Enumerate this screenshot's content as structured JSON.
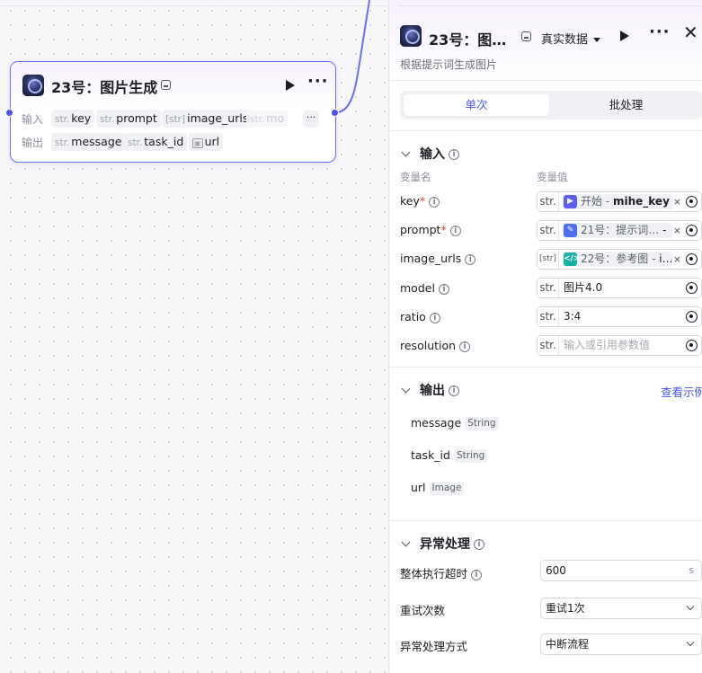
{
  "node": {
    "title": "23号：图片生成",
    "input_label": "输入",
    "output_label": "输出",
    "inputs": [
      {
        "type": "str.",
        "name": "key"
      },
      {
        "type": "str.",
        "name": "prompt"
      },
      {
        "type": "[str]",
        "name": "image_urls"
      },
      {
        "type": "str.",
        "name": "mo"
      }
    ],
    "outputs": [
      {
        "type": "str.",
        "name": "message"
      },
      {
        "type": "str.",
        "name": "task_id"
      },
      {
        "type": "img",
        "name": "url"
      }
    ],
    "more": "···"
  },
  "panel": {
    "title": "23号：图…",
    "data_mode": "真实数据",
    "description": "根据提示词生成图片",
    "tabs": [
      "单次",
      "批处理"
    ],
    "input_section": "输入",
    "col_name": "变量名",
    "col_value": "变量值",
    "inputs": [
      {
        "name": "key",
        "required": "*",
        "type": "str.",
        "ref_source": "开始 - ",
        "ref_var": "mihe_key",
        "ref_icon_color": "#5b5ff0"
      },
      {
        "name": "prompt",
        "required": "*",
        "type": "str.",
        "ref_source": "21号：提示词… ",
        "ref_var": "- ",
        "ref_icon_color": "#4d6ef7"
      },
      {
        "name": "image_urls",
        "required": "",
        "type": "[str]",
        "ref_source": "22号：参考图 - ",
        "ref_var": "i…",
        "ref_icon_color": "#15b3a5"
      },
      {
        "name": "model",
        "required": "",
        "type": "str.",
        "value": "图片4.0"
      },
      {
        "name": "ratio",
        "required": "",
        "type": "str.",
        "value": "3:4"
      },
      {
        "name": "resolution",
        "required": "",
        "type": "str.",
        "placeholder": "输入或引用参数值"
      }
    ],
    "output_section": "输出",
    "view_example": "查看示例",
    "outputs": [
      {
        "name": "message",
        "type": "String"
      },
      {
        "name": "task_id",
        "type": "String"
      },
      {
        "name": "url",
        "type": "Image"
      }
    ],
    "error_section": "异常处理",
    "timeout_label": "整体执行超时",
    "timeout_value": "600",
    "timeout_unit": "s",
    "retry_label": "重试次数",
    "retry_value": "重试1次",
    "error_mode_label": "异常处理方式",
    "error_mode_value": "中断流程"
  },
  "colors": {
    "accent": "#4d53e8",
    "node_border": "#6b6ef5"
  }
}
